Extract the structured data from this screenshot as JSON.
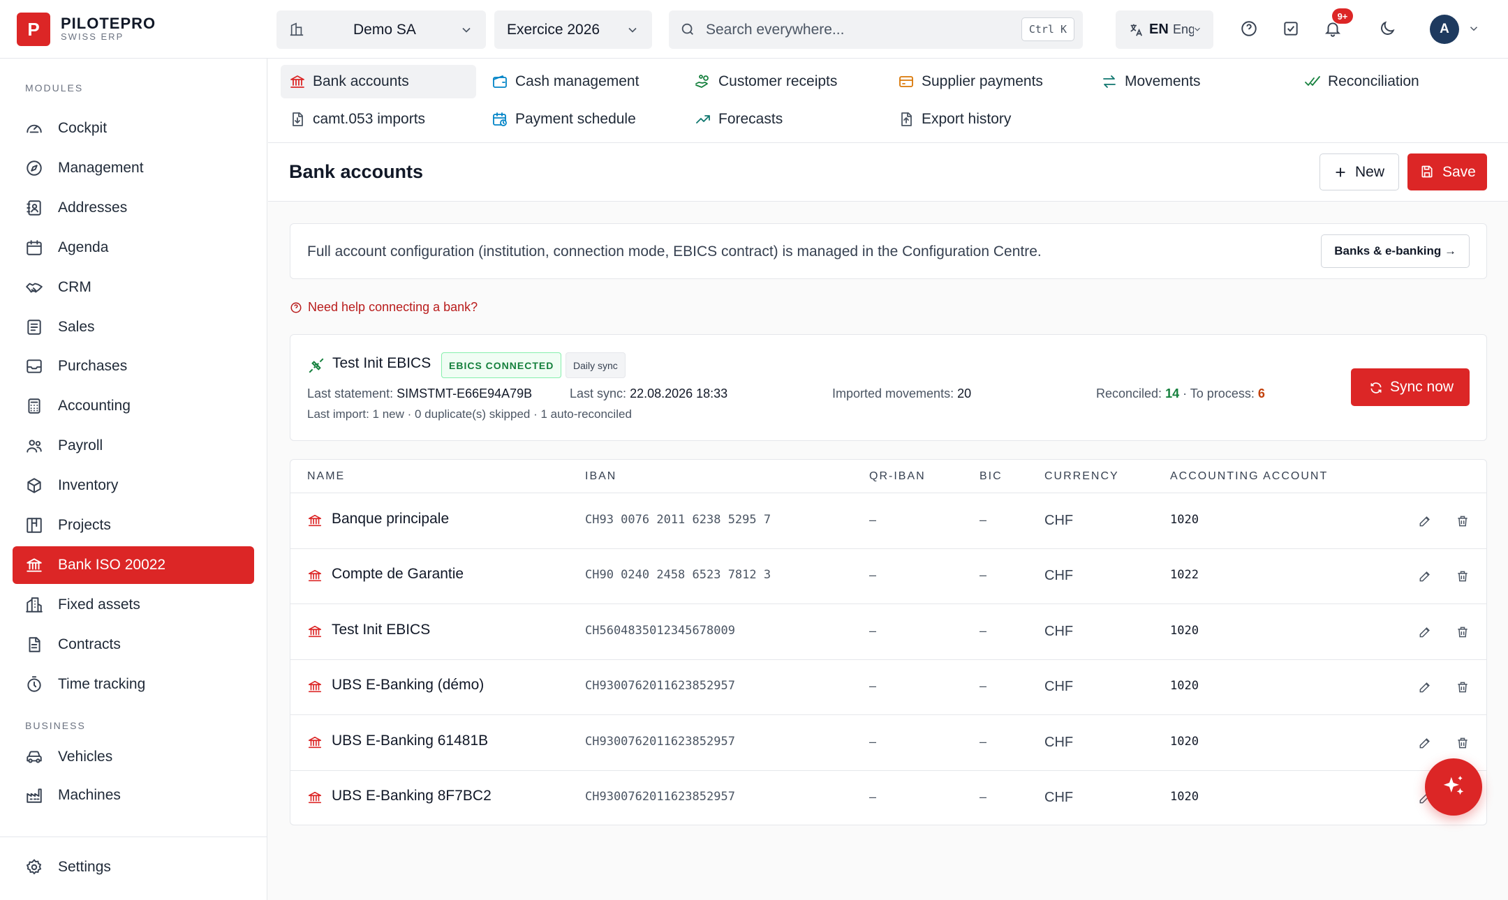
{
  "app": {
    "name": "PILOTEPRO",
    "subtitle": "SWISS ERP",
    "logo_letter": "P"
  },
  "topbar": {
    "company": "Demo SA",
    "fiscal_year": "Exercice 2026",
    "search_placeholder": "Search everywhere...",
    "search_shortcut": "Ctrl K",
    "language_code": "EN",
    "language_name": "Eng",
    "notifications_badge": "9+",
    "avatar_initial": "A"
  },
  "sidebar": {
    "modules_label": "MODULES",
    "business_label": "BUSINESS",
    "modules": [
      {
        "label": "Cockpit",
        "icon": "gauge-icon"
      },
      {
        "label": "Management",
        "icon": "compass-icon"
      },
      {
        "label": "Addresses",
        "icon": "contact-book-icon"
      },
      {
        "label": "Agenda",
        "icon": "calendar-icon"
      },
      {
        "label": "CRM",
        "icon": "handshake-icon"
      },
      {
        "label": "Sales",
        "icon": "receipt-icon"
      },
      {
        "label": "Purchases",
        "icon": "inbox-icon"
      },
      {
        "label": "Accounting",
        "icon": "calculator-icon"
      },
      {
        "label": "Payroll",
        "icon": "users-icon"
      },
      {
        "label": "Inventory",
        "icon": "box-icon"
      },
      {
        "label": "Projects",
        "icon": "kanban-icon"
      },
      {
        "label": "Bank ISO 20022",
        "icon": "bank-icon",
        "active": true
      },
      {
        "label": "Fixed assets",
        "icon": "building-icon"
      },
      {
        "label": "Contracts",
        "icon": "document-icon"
      },
      {
        "label": "Time tracking",
        "icon": "timer-icon"
      }
    ],
    "business": [
      {
        "label": "Vehicles",
        "icon": "car-icon"
      },
      {
        "label": "Machines",
        "icon": "factory-icon"
      }
    ],
    "settings_label": "Settings"
  },
  "tabs": [
    {
      "label": "Bank accounts",
      "icon": "bank-icon",
      "active": true
    },
    {
      "label": "Cash management",
      "icon": "wallet-icon"
    },
    {
      "label": "Customer receipts",
      "icon": "hand-coins-icon"
    },
    {
      "label": "Supplier payments",
      "icon": "credit-card-icon"
    },
    {
      "label": "Movements",
      "icon": "arrows-swap-icon"
    },
    {
      "label": "Reconciliation",
      "icon": "check-check-icon"
    },
    {
      "label": "camt.053 imports",
      "icon": "file-import-icon"
    },
    {
      "label": "Payment schedule",
      "icon": "calendar-clock-icon"
    },
    {
      "label": "Forecasts",
      "icon": "trend-up-icon"
    },
    {
      "label": "Export history",
      "icon": "file-export-icon"
    }
  ],
  "page": {
    "title": "Bank accounts",
    "new_label": "New",
    "save_label": "Save"
  },
  "info": {
    "text": "Full account configuration (institution, connection mode, EBICS contract) is managed in the Configuration Centre.",
    "button": "Banks & e-banking →"
  },
  "help_link": "Need help connecting a bank?",
  "ebics": {
    "name": "Test Init EBICS",
    "status": "EBICS CONNECTED",
    "sync_mode": "Daily sync",
    "last_statement_label": "Last statement:",
    "last_statement": "SIMSTMT-E66E94A79B",
    "last_sync_label": "Last sync:",
    "last_sync": "22.08.2026 18:33",
    "imported_label": "Imported movements:",
    "imported": "20",
    "reconciled_label": "Reconciled:",
    "reconciled": "14",
    "to_process_label": "· To process:",
    "to_process": "6",
    "last_import": "Last import: 1 new · 0 duplicate(s) skipped · 1 auto-reconciled",
    "sync_button": "Sync now",
    "colors": {
      "reconciled": "#15803d",
      "to_process": "#c2410c"
    }
  },
  "table": {
    "headers": [
      "NAME",
      "IBAN",
      "QR-IBAN",
      "BIC",
      "CURRENCY",
      "ACCOUNTING ACCOUNT"
    ],
    "rows": [
      {
        "name": "Banque principale",
        "iban": "CH93 0076 2011 6238 5295 7",
        "qr_iban": "–",
        "bic": "–",
        "currency": "CHF",
        "account": "1020"
      },
      {
        "name": "Compte de Garantie",
        "iban": "CH90 0240 2458 6523 7812 3",
        "qr_iban": "–",
        "bic": "–",
        "currency": "CHF",
        "account": "1022"
      },
      {
        "name": "Test Init EBICS",
        "iban": "CH5604835012345678009",
        "qr_iban": "–",
        "bic": "–",
        "currency": "CHF",
        "account": "1020"
      },
      {
        "name": "UBS E-Banking (démo)",
        "iban": "CH9300762011623852957",
        "qr_iban": "–",
        "bic": "–",
        "currency": "CHF",
        "account": "1020"
      },
      {
        "name": "UBS E-Banking 61481B",
        "iban": "CH9300762011623852957",
        "qr_iban": "–",
        "bic": "–",
        "currency": "CHF",
        "account": "1020"
      },
      {
        "name": "UBS E-Banking 8F7BC2",
        "iban": "CH9300762011623852957",
        "qr_iban": "–",
        "bic": "–",
        "currency": "CHF",
        "account": "1020"
      }
    ]
  },
  "colors": {
    "brand": "#dc2626",
    "text": "#1f2937"
  }
}
